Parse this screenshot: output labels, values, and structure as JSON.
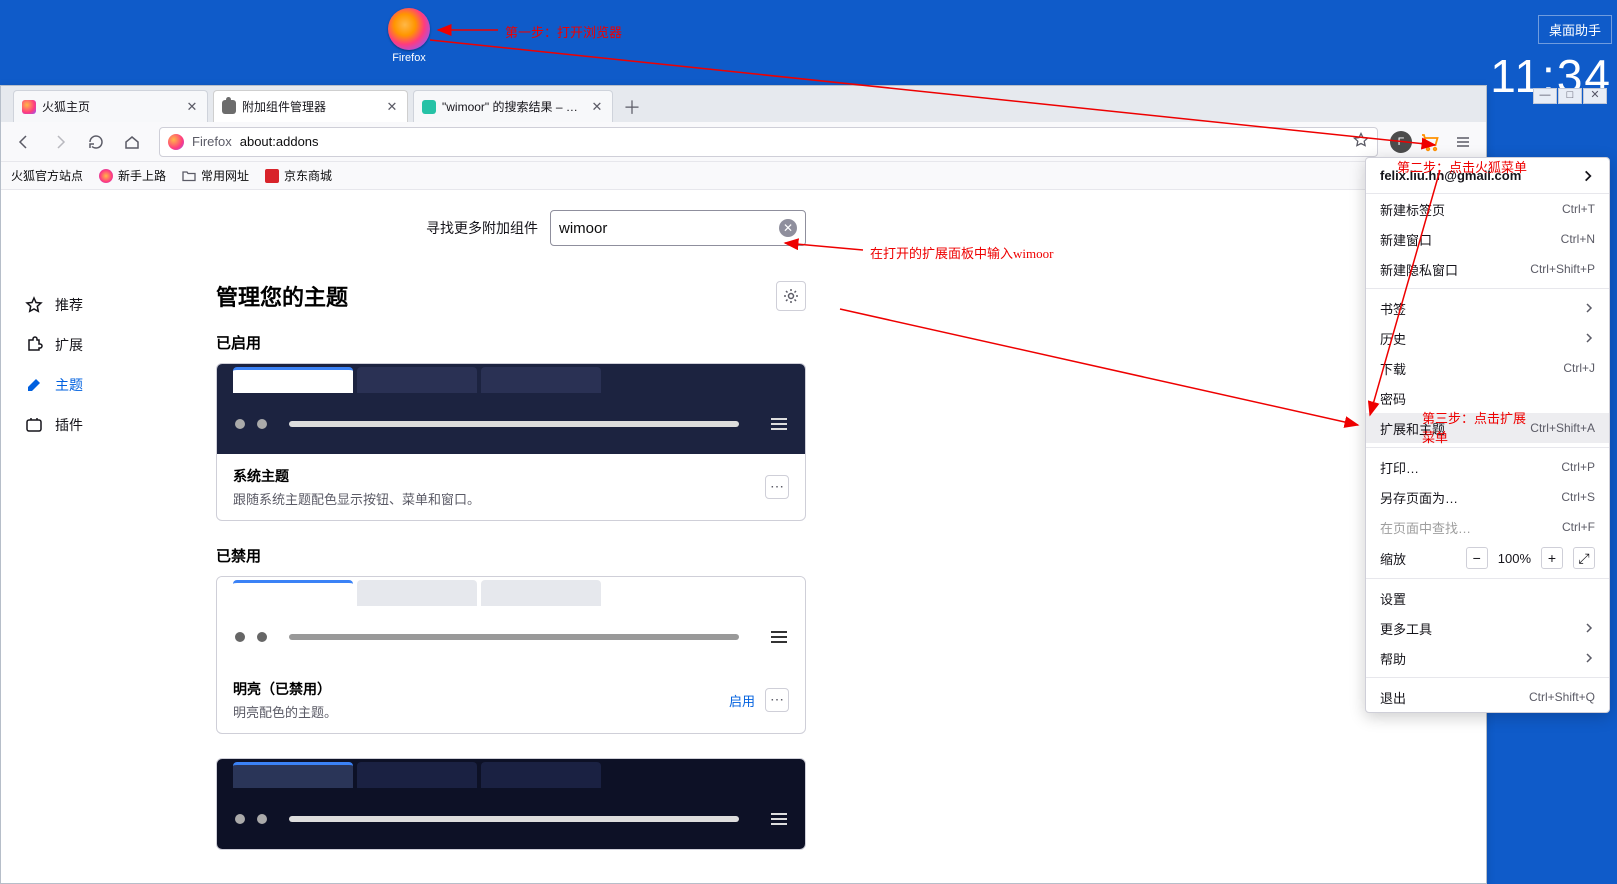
{
  "desktop": {
    "icon_label": "Firefox"
  },
  "widget": {
    "helper": "桌面助手",
    "time": "11:34"
  },
  "tabs": {
    "t0": "火狐主页",
    "t1": "附加组件管理器",
    "t2": "\"wimoor\" 的搜索结果 – Firef..."
  },
  "url": {
    "prefix": "Firefox",
    "path": "about:addons",
    "avatar": "F"
  },
  "bookmarks": {
    "b0": "火狐官方站点",
    "b1": "新手上路",
    "b2": "常用网址",
    "b3": "京东商城"
  },
  "sidebar": {
    "s0": "推荐",
    "s1": "扩展",
    "s2": "主题",
    "s3": "插件"
  },
  "search": {
    "label": "寻找更多附加组件",
    "value": "wimoor"
  },
  "heading": "管理您的主题",
  "sections": {
    "enabled": "已启用",
    "disabled": "已禁用"
  },
  "themes": {
    "sys": {
      "name": "系统主题",
      "desc": "跟随系统主题配色显示按钮、菜单和窗口。"
    },
    "light": {
      "name": "明亮（已禁用）",
      "desc": "明亮配色的主题。",
      "enable": "启用"
    }
  },
  "menu": {
    "email": "felix.liu.hn@gmail.com",
    "newtab": {
      "l": "新建标签页",
      "s": "Ctrl+T"
    },
    "newwin": {
      "l": "新建窗口",
      "s": "Ctrl+N"
    },
    "newpriv": {
      "l": "新建隐私窗口",
      "s": "Ctrl+Shift+P"
    },
    "bookmark": "书签",
    "history": "历史",
    "download": {
      "l": "下载",
      "s": "Ctrl+J"
    },
    "password": "密码",
    "ext": {
      "l": "扩展和主题",
      "s": "Ctrl+Shift+A"
    },
    "print": {
      "l": "打印…",
      "s": "Ctrl+P"
    },
    "save": {
      "l": "另存页面为…",
      "s": "Ctrl+S"
    },
    "find": {
      "l": "在页面中查找…",
      "s": "Ctrl+F"
    },
    "zoom": {
      "l": "缩放",
      "v": "100%"
    },
    "settings": "设置",
    "moretools": "更多工具",
    "help": "帮助",
    "quit": {
      "l": "退出",
      "s": "Ctrl+Shift+Q"
    }
  },
  "anno": {
    "a1": "第一步：打开浏览器",
    "a2": "第二步：点击火狐菜单",
    "a3": "在打开的扩展面板中输入wimoor",
    "a4": "第三步：点击扩展菜单"
  }
}
